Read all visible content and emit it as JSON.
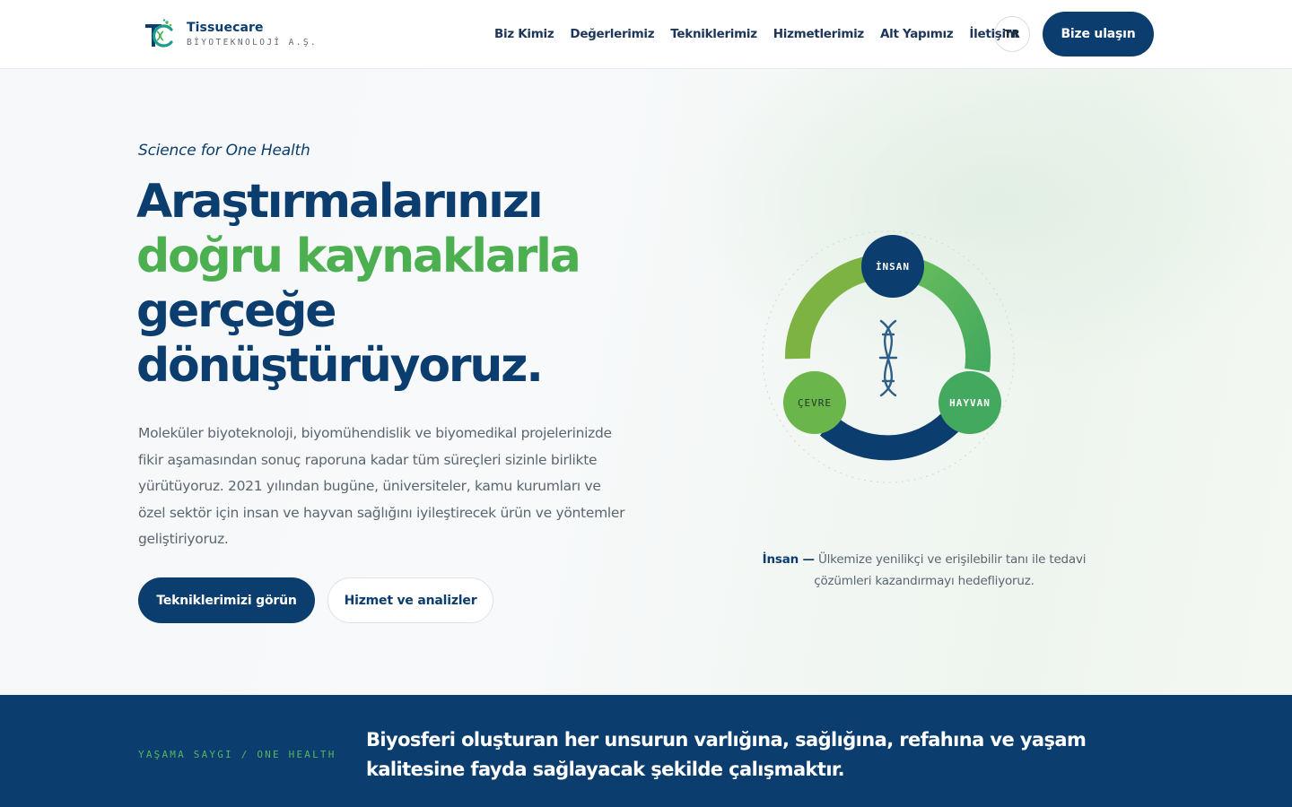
{
  "brand": {
    "name": "Tissuecare",
    "subtitle": "BİYOTEKNOLOJİ A.Ş."
  },
  "nav": {
    "items": [
      {
        "label": "Biz Kimiz"
      },
      {
        "label": "Değerlerimiz"
      },
      {
        "label": "Tekniklerimiz"
      },
      {
        "label": "Hizmetlerimiz"
      },
      {
        "label": "Alt Yapımız"
      },
      {
        "label": "İletişim"
      }
    ],
    "language": "TR",
    "cta_label": "Bize ulaşın"
  },
  "hero": {
    "tagline": "Science for One Health",
    "headline": {
      "line1": "Araştırmalarınızı",
      "line2": "doğru kaynaklarla",
      "line3": "gerçeğe",
      "line4": "dönüştürüyoruz."
    },
    "description": "Moleküler biyoteknoloji, biyomühendislik ve biyomedikal projelerinizde fikir aşamasından sonuç raporuna kadar tüm süreçleri sizinle birlikte yürütüyoruz. 2021 yılından bugüne, üniversiteler, kamu kurumları ve özel sektör için insan ve hayvan sağlığını iyileştirecek ürün ve yöntemler geliştiriyoruz.",
    "primary_button": "Tekniklerimizi görün",
    "secondary_button": "Hizmet ve analizler"
  },
  "diagram": {
    "nodes": {
      "human": "İNSAN",
      "animal": "HAYVAN",
      "environment": "ÇEVRE"
    },
    "colors": {
      "navy": "#0b3d6e",
      "green": "#4caf50",
      "light_green": "#7cb342"
    },
    "caption_label": "İnsan —",
    "caption_text": "Ülkemize yenilikçi ve erişilebilir tanı ile tedavi çözümleri kazandırmayı hedefliyoruz."
  },
  "band": {
    "label": "YAŞAMA SAYGI / ONE HEALTH",
    "text": "Biyosferi oluşturan her unsurun varlığına, sağlığına, refahına ve yaşam kalitesine fayda sağlayacak şekilde çalışmaktır."
  }
}
